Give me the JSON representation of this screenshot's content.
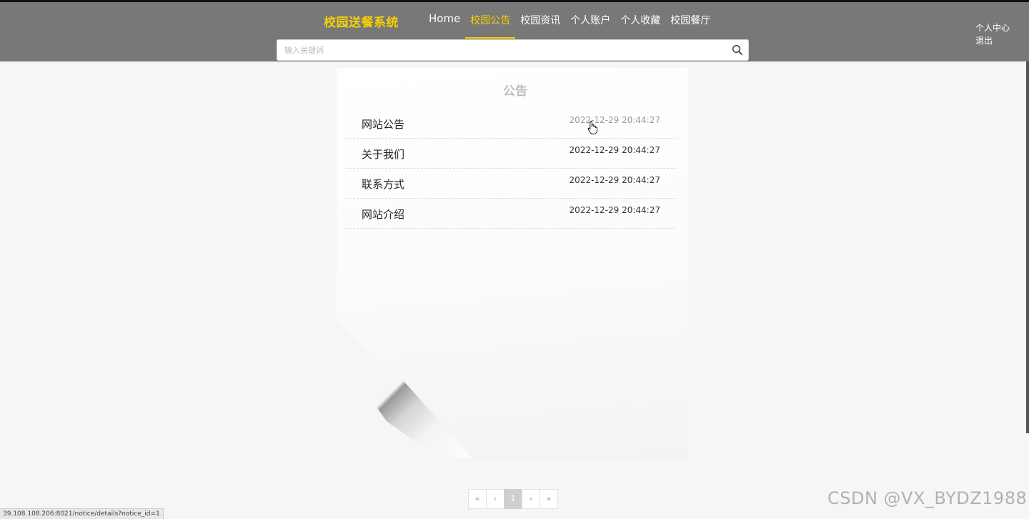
{
  "header": {
    "brand": "校园送餐系统",
    "nav": [
      {
        "label": "Home"
      },
      {
        "label": "校园公告"
      },
      {
        "label": "校园资讯"
      },
      {
        "label": "个人账户"
      },
      {
        "label": "个人收藏"
      },
      {
        "label": "校园餐厅"
      }
    ],
    "active_nav": "校园公告",
    "search": {
      "placeholder": "输入关键词",
      "value": ""
    },
    "user_links": {
      "center": "个人中心",
      "logout": "退出"
    }
  },
  "notice": {
    "title": "公告",
    "items": [
      {
        "title": "网站公告",
        "time": "2022-12-29 20:44:27"
      },
      {
        "title": "关于我们",
        "time": "2022-12-29 20:44:27"
      },
      {
        "title": "联系方式",
        "time": "2022-12-29 20:44:27"
      },
      {
        "title": "网站介绍",
        "time": "2022-12-29 20:44:27"
      }
    ]
  },
  "pagination": {
    "first": "«",
    "prev": "‹",
    "current": "1",
    "next": "›",
    "last": "»"
  },
  "status_url": "39.108.108.206:8021/notice/details?notice_id=1",
  "watermark": "CSDN @VX_BYDZ1988",
  "colors": {
    "header_bg": "#787878",
    "accent": "#f5d000",
    "page_bg": "#f6f6f6"
  }
}
